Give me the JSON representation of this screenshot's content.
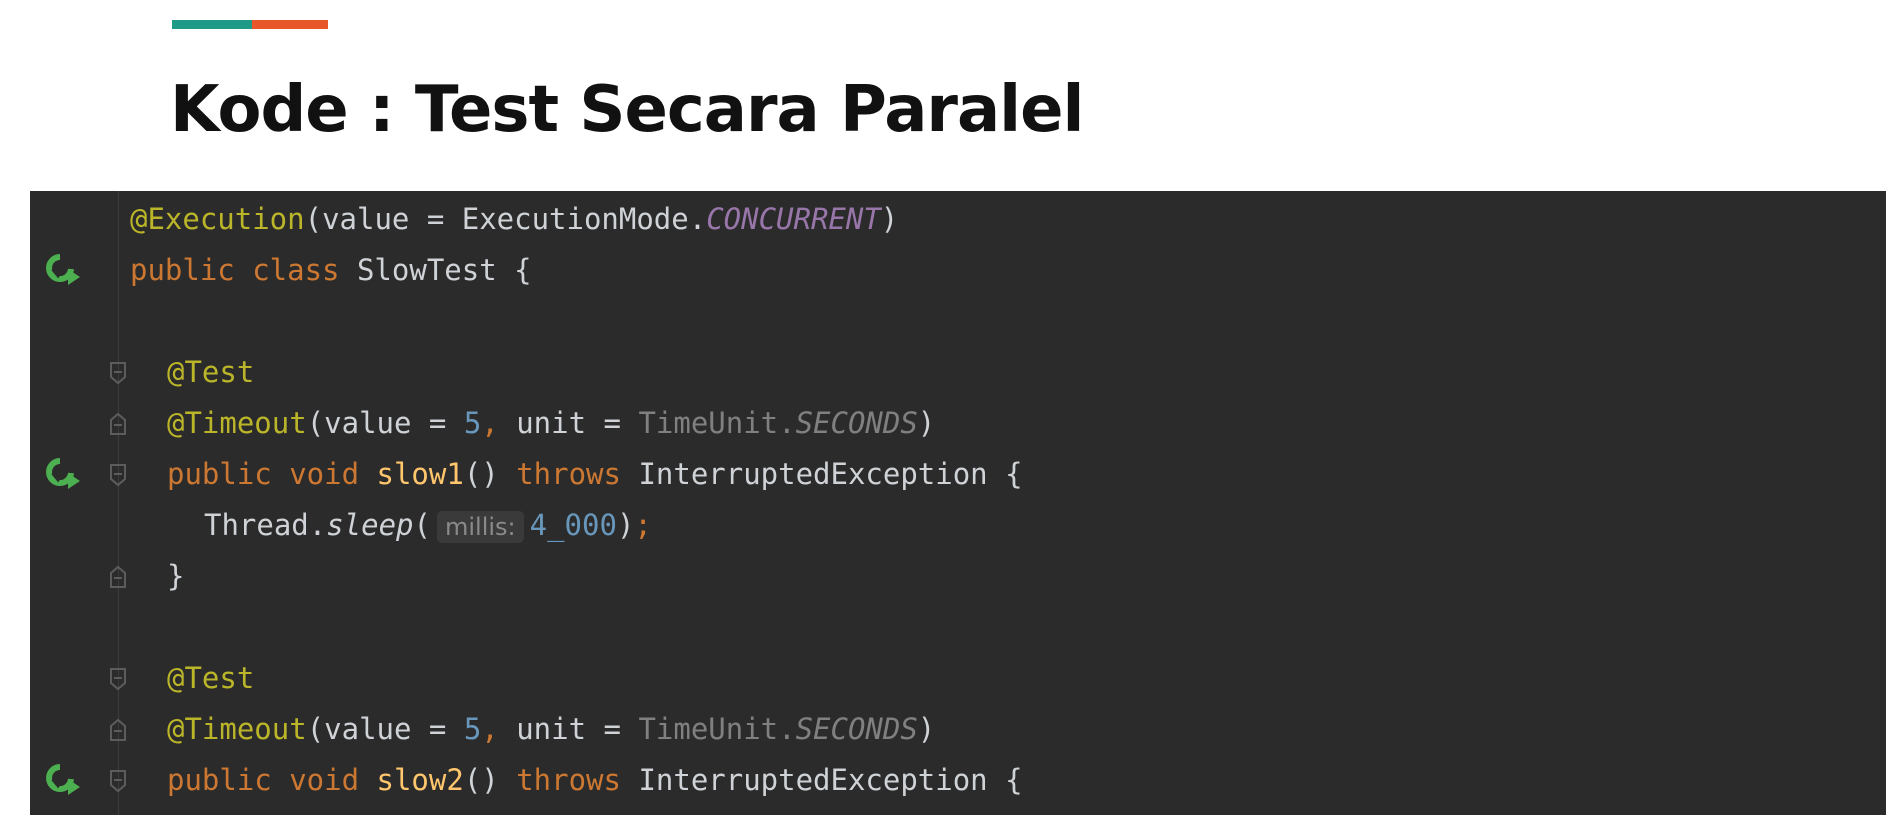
{
  "slide": {
    "title": "Kode : Test Secara Paralel",
    "accent_colors": [
      "#1f9a86",
      "#e8572a"
    ]
  },
  "editor": {
    "background": "#2b2b2b",
    "code": {
      "l1": {
        "a": "@Execution",
        "b": "(value = ExecutionMode.",
        "c": "CONCURRENT",
        "d": ")"
      },
      "l2": {
        "a": "public class",
        "b": " SlowTest {"
      },
      "l4": {
        "a": "@Test"
      },
      "l5": {
        "a": "@Timeout",
        "b": "(value = ",
        "c": "5",
        "d": ", ",
        "e": "unit = ",
        "f": "TimeUnit.",
        "g": "SECONDS",
        "h": ")"
      },
      "l6": {
        "a": "public void ",
        "b": "slow1",
        "c": "() ",
        "d": "throws",
        "e": " InterruptedException {"
      },
      "l7": {
        "a": "Thread.",
        "b": "sleep",
        "c": "(",
        "hint": "millis:",
        "d": "4_000",
        "e": ")",
        "f": ";"
      },
      "l8": {
        "a": "}"
      },
      "l10": {
        "a": "@Test"
      },
      "l11": {
        "a": "@Timeout",
        "b": "(value = ",
        "c": "5",
        "d": ", ",
        "e": "unit = ",
        "f": "TimeUnit.",
        "g": "SECONDS",
        "h": ")"
      },
      "l12": {
        "a": "public void ",
        "b": "slow2",
        "c": "() ",
        "d": "throws",
        "e": " InterruptedException {"
      }
    },
    "gutter_icons": {
      "run": "run-test-icon",
      "fold": "fold-marker-icon"
    }
  }
}
